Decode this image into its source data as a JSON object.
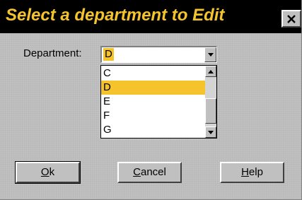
{
  "dialog": {
    "title": "Select a department to Edit"
  },
  "department": {
    "label": "Department:",
    "value": "D"
  },
  "list": {
    "items": [
      "C",
      "D",
      "E",
      "F",
      "G"
    ],
    "selected": "D"
  },
  "buttons": {
    "ok": {
      "mnemonic": "O",
      "rest": "k"
    },
    "cancel": {
      "mnemonic": "C",
      "rest": "ancel"
    },
    "help": {
      "mnemonic": "H",
      "rest": "elp"
    }
  },
  "icons": {
    "close": "close-icon",
    "dropdown": "chevron-down-icon",
    "scroll_up": "scroll-up-icon",
    "scroll_down": "scroll-down-icon"
  },
  "colors": {
    "accent": "#f5c42c",
    "titlebar": "#000000",
    "dialog_bg": "#c3c3c3"
  }
}
